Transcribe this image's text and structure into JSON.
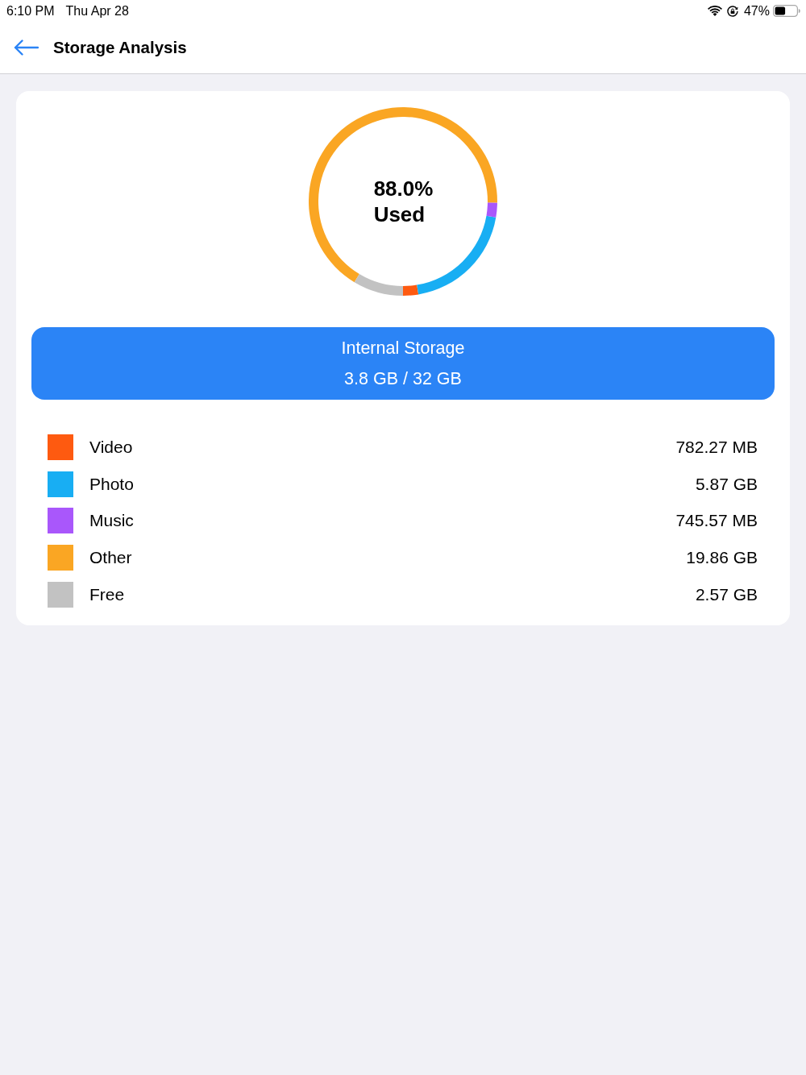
{
  "status_bar": {
    "time": "6:10 PM",
    "date": "Thu Apr 28",
    "battery_percent": "47%"
  },
  "header": {
    "title": "Storage Analysis"
  },
  "usage": {
    "percent": "88.0%",
    "caption": "Used",
    "chart_data": {
      "type": "donut",
      "values": [
        2.62,
        19.68,
        2.5,
        66.58,
        8.62
      ]
    }
  },
  "storage_banner": {
    "title": "Internal Storage",
    "summary": "3.8 GB / 32 GB"
  },
  "storage_items": [
    {
      "label": "Video",
      "size": "782.27 MB",
      "color": "#fe5a10"
    },
    {
      "label": "Photo",
      "size": "5.87 GB",
      "color": "#18aef3"
    },
    {
      "label": "Music",
      "size": "745.57 MB",
      "color": "#a957fb"
    },
    {
      "label": "Other",
      "size": "19.86 GB",
      "color": "#faa623"
    },
    {
      "label": "Free",
      "size": "2.57 GB",
      "color": "#c2c2c2"
    }
  ]
}
